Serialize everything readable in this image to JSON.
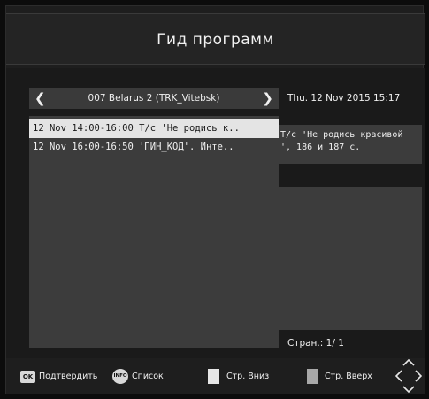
{
  "header": {
    "title": "Гид программ"
  },
  "channel": {
    "name": "007 Belarus 2 (TRK_Vitebsk)",
    "prev_icon": "chevron-left-icon",
    "next_icon": "chevron-right-icon"
  },
  "datetime": "Thu.   12 Nov 2015 15:17",
  "programs": [
    {
      "text": "12 Nov 14:00-16:00  Т/с 'Не родись к..",
      "selected": true
    },
    {
      "text": "12 Nov 16:00-16:50  'ПИН_КОД'. Инте..",
      "selected": false
    }
  ],
  "description": "Т/с 'Не родись красивой\n', 186 и 187 с.",
  "page": {
    "label": "Стран.:",
    "value": "1/ 1"
  },
  "footer": {
    "ok_key": "OK",
    "ok_label": "Подтвердить",
    "info_key": "INFO",
    "info_label": "Список",
    "page_down_label": "Стр. Вниз",
    "page_up_label": "Стр. Вверх",
    "page_down_color": "#e6e6e6",
    "page_up_color": "#a8a8a8",
    "nav_icon": "up-down-left-right-arrows-icon"
  },
  "colors": {
    "background": "#1a1a1a",
    "panel": "#3c3c3c",
    "selected_row": "#e4e4e4",
    "text": "#f0f0f0"
  }
}
